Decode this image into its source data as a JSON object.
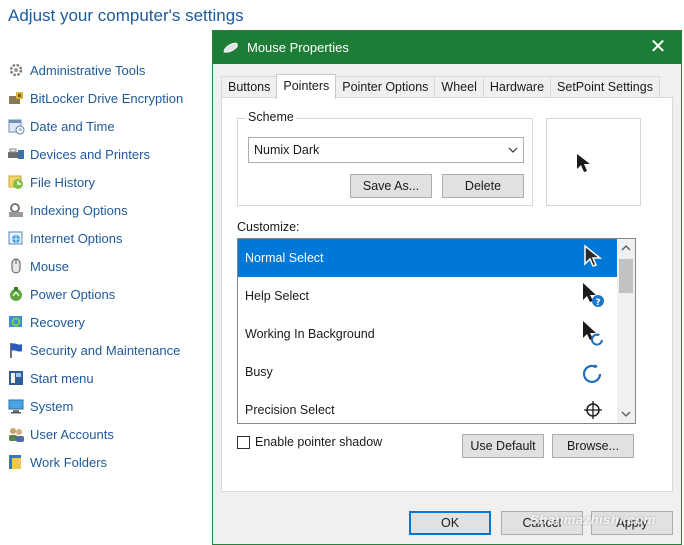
{
  "control_panel": {
    "title": "Adjust your computer's settings",
    "items": [
      {
        "label": "Administrative Tools",
        "icon": "administrative-tools-icon"
      },
      {
        "label": "BitLocker Drive Encryption",
        "icon": "bitlocker-icon"
      },
      {
        "label": "Date and Time",
        "icon": "date-time-icon"
      },
      {
        "label": "Devices and Printers",
        "icon": "devices-printers-icon"
      },
      {
        "label": "File History",
        "icon": "file-history-icon"
      },
      {
        "label": "Indexing Options",
        "icon": "indexing-options-icon"
      },
      {
        "label": "Internet Options",
        "icon": "internet-options-icon"
      },
      {
        "label": "Mouse",
        "icon": "mouse-icon"
      },
      {
        "label": "Power Options",
        "icon": "power-options-icon"
      },
      {
        "label": "Recovery",
        "icon": "recovery-icon"
      },
      {
        "label": "Security and Maintenance",
        "icon": "security-flag-icon"
      },
      {
        "label": "Start menu",
        "icon": "start-menu-icon"
      },
      {
        "label": "System",
        "icon": "system-icon"
      },
      {
        "label": "User Accounts",
        "icon": "user-accounts-icon"
      },
      {
        "label": "Work Folders",
        "icon": "work-folders-icon"
      }
    ]
  },
  "dialog": {
    "title": "Mouse Properties",
    "close_glyph": "✕",
    "titlebar_color": "#1d7d36",
    "tabs": [
      "Buttons",
      "Pointers",
      "Pointer Options",
      "Wheel",
      "Hardware",
      "SetPoint Settings"
    ],
    "active_tab": "Pointers",
    "scheme": {
      "label": "Scheme",
      "selected": "Numix Dark",
      "save_as_label": "Save As...",
      "delete_label": "Delete"
    },
    "customize": {
      "label": "Customize:",
      "selection_color": "#0078d7",
      "rows": [
        {
          "label": "Normal Select",
          "cursor": "arrow-cursor-icon"
        },
        {
          "label": "Help Select",
          "cursor": "help-cursor-icon"
        },
        {
          "label": "Working In Background",
          "cursor": "working-cursor-icon"
        },
        {
          "label": "Busy",
          "cursor": "busy-cursor-icon"
        },
        {
          "label": "Precision Select",
          "cursor": "crosshair-cursor-icon"
        }
      ],
      "selected_row": "Normal Select"
    },
    "shadow_checkbox_label": "Enable pointer shadow",
    "shadow_checked": false,
    "use_default_label": "Use Default",
    "browse_label": "Browse...",
    "ok_label": "OK",
    "cancel_label": "Cancel",
    "apply_label": "Apply"
  },
  "watermark": "Shanmazhishi.com"
}
